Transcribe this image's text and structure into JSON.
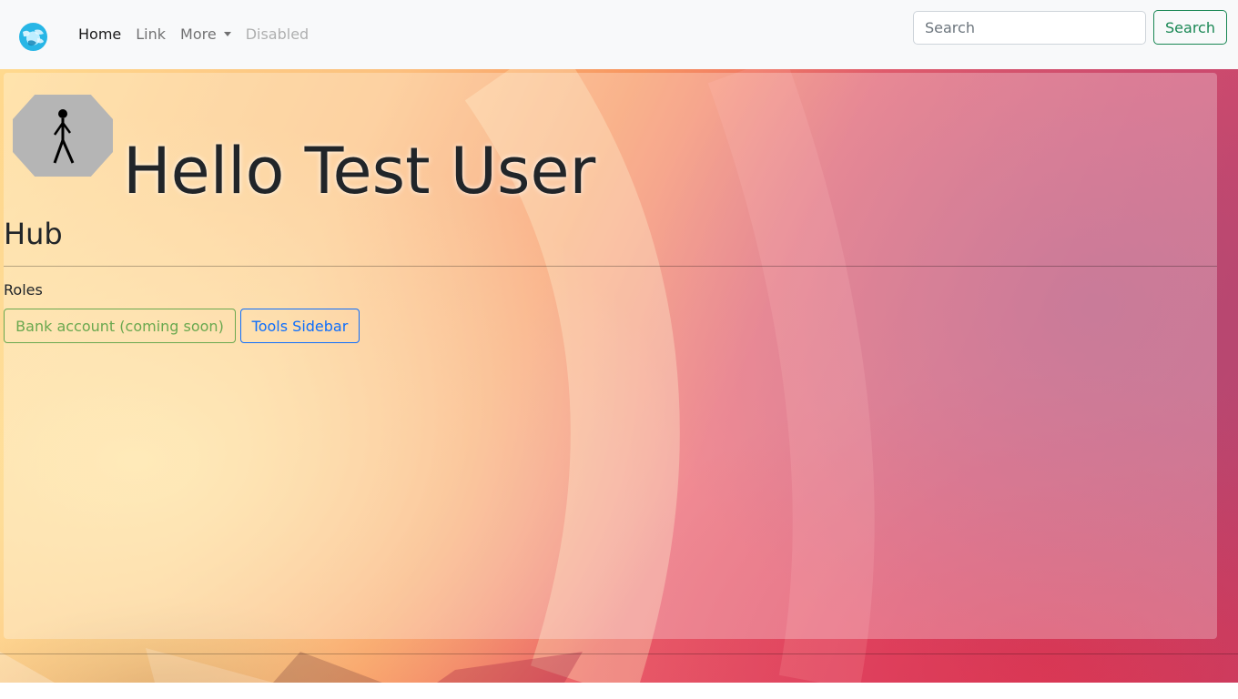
{
  "navbar": {
    "brand_icon": "globe-icon",
    "links": [
      {
        "label": "Home",
        "state": "active"
      },
      {
        "label": "Link",
        "state": "normal"
      },
      {
        "label": "More",
        "state": "dropdown"
      },
      {
        "label": "Disabled",
        "state": "disabled"
      }
    ],
    "search": {
      "placeholder": "Search",
      "value": "",
      "button_label": "Search"
    }
  },
  "main": {
    "avatar_icon": "stick-figure-icon",
    "greeting": "Hello Test User",
    "section_title": "Hub",
    "roles_label": "Roles",
    "buttons": [
      {
        "label": "Bank account (coming soon)",
        "enabled": false
      },
      {
        "label": "Tools Sidebar",
        "enabled": true
      }
    ]
  },
  "colors": {
    "navbar_bg": "#f8f9fa",
    "search_accent": "#198754",
    "bank_button": "#6aa84f",
    "tools_button": "#0d6efd",
    "text": "#212529"
  }
}
